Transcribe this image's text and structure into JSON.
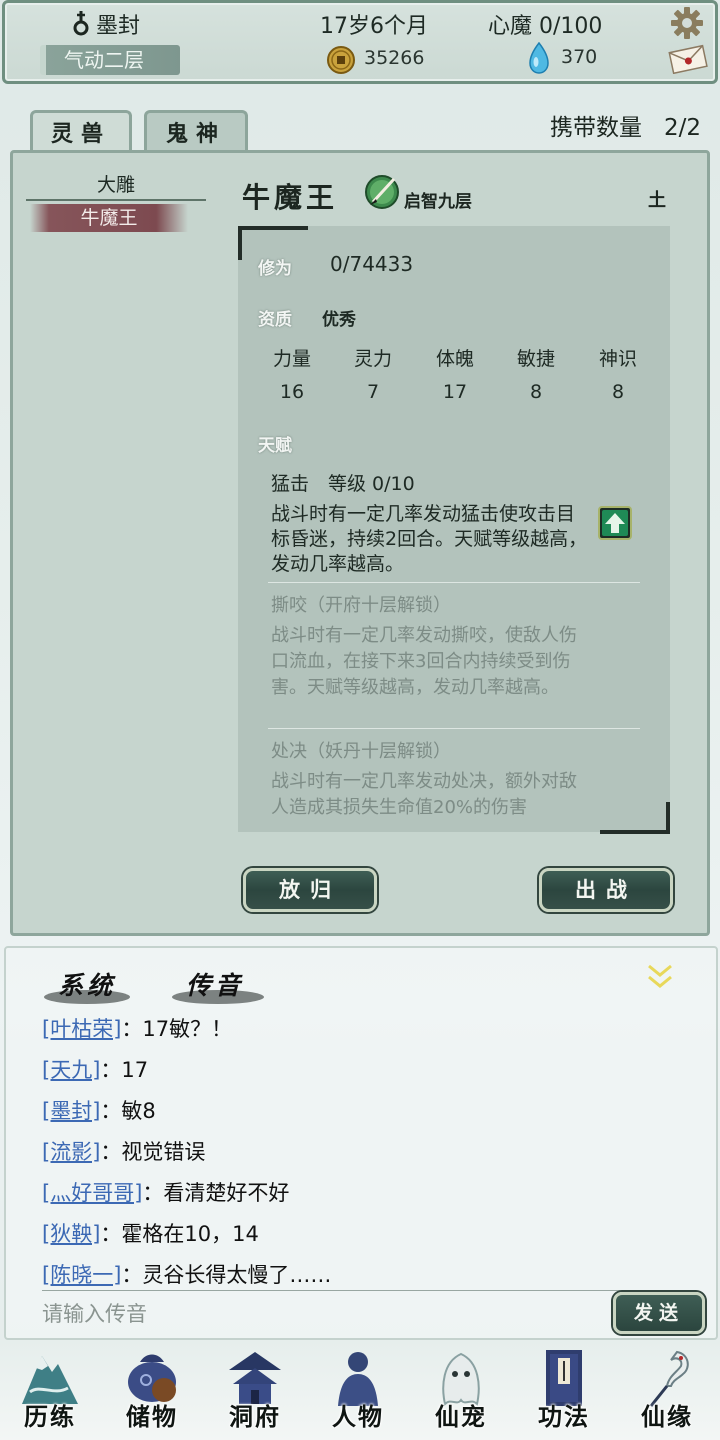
{
  "header": {
    "player_name": "墨封",
    "realm": "气动二层",
    "age": "17岁6个月",
    "heart_demon": "心魔 0/100",
    "coins": "35266",
    "gems": "370",
    "icons": {
      "gender": "male-symbol-icon",
      "coin": "coin-icon",
      "gem": "spirit-gem-icon",
      "settings": "gear-icon",
      "mail": "mail-icon"
    }
  },
  "tabs": [
    {
      "label": "灵兽",
      "active": true
    },
    {
      "label": "鬼神",
      "active": false
    }
  ],
  "carry": {
    "label": "携带数量",
    "value": "2/2"
  },
  "beast_list": [
    {
      "name": "大雕",
      "selected": false
    },
    {
      "name": "牛魔王",
      "selected": true
    }
  ],
  "beast": {
    "name": "牛魔王",
    "level": "启智九层",
    "element": "土",
    "cultivation_label": "修为",
    "cultivation": "0/74433",
    "aptitude_label": "资质",
    "aptitude": "优秀",
    "stats": [
      {
        "label": "力量",
        "value": "16"
      },
      {
        "label": "灵力",
        "value": "7"
      },
      {
        "label": "体魄",
        "value": "17"
      },
      {
        "label": "敏捷",
        "value": "8"
      },
      {
        "label": "神识",
        "value": "8"
      }
    ],
    "talent_label": "天赋",
    "talents": [
      {
        "title": "猛击　等级  0/10",
        "desc": "战斗时有一定几率发动猛击使攻击目标昏迷，持续2回合。天赋等级越高，发动几率越高。",
        "locked": false
      },
      {
        "title": "撕咬（开府十层解锁）",
        "desc": "战斗时有一定几率发动撕咬，使敌人伤口流血，在接下来3回合内持续受到伤害。天赋等级越高，发动几率越高。",
        "locked": true
      },
      {
        "title": "处决（妖丹十层解锁）",
        "desc": "战斗时有一定几率发动处决，额外对敌人造成其损失生命值20%的伤害",
        "locked": true
      }
    ]
  },
  "actions": {
    "release": "放归",
    "battle": "出战"
  },
  "chat": {
    "tabs": [
      "系统",
      "传音"
    ],
    "messages": [
      {
        "sender": "[叶枯荣]",
        "text": "：17敏？！"
      },
      {
        "sender": "[天九]",
        "text": "：17"
      },
      {
        "sender": "[墨封]",
        "text": "：敏8"
      },
      {
        "sender": "[流影]",
        "text": "：视觉错误"
      },
      {
        "sender": "[灬好哥哥]",
        "text": "：看清楚好不好"
      },
      {
        "sender": "[狄鞅]",
        "text": "：霍格在10，14"
      },
      {
        "sender": "[陈晓一]",
        "text": "：灵谷长得太慢了……"
      }
    ],
    "input_placeholder": "请输入传音",
    "send": "发送"
  },
  "bottom_nav": [
    {
      "label": "历练",
      "icon": "mountain-icon"
    },
    {
      "label": "储物",
      "icon": "storage-bag-icon"
    },
    {
      "label": "洞府",
      "icon": "pavilion-icon"
    },
    {
      "label": "人物",
      "icon": "character-icon"
    },
    {
      "label": "仙宠",
      "icon": "pet-icon"
    },
    {
      "label": "功法",
      "icon": "scripture-book-icon"
    },
    {
      "label": "仙缘",
      "icon": "crane-icon"
    }
  ]
}
